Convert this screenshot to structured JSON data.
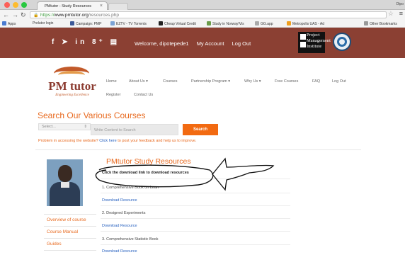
{
  "browser": {
    "tab_title": "PMtutor - Study Resources",
    "tab_close": "×",
    "profile": "Dipo",
    "url_scheme": "https://",
    "url_host": "www.pmtutor.org",
    "url_path": "/resources.php",
    "bookmarks": [
      "Apps",
      "Prelutor login",
      "Campaign: PMP",
      "EZTV - TV Torrents",
      "Cheap Virtual Credit",
      "Study in Norway!Vis",
      "GG.app",
      "Metropolis UAS - Ad"
    ],
    "other_bookmarks": "Other Bookmarks"
  },
  "banner": {
    "welcome": "Welcome, dipotepede1",
    "my_account": "My Account",
    "logout": "Log Out",
    "pmi_lines": [
      "Project",
      "Management",
      "Institute"
    ]
  },
  "logo": {
    "name": "PM tutor",
    "tagline": "Engineering Excellence"
  },
  "nav": {
    "home": "Home",
    "about": "About Us ▾",
    "courses": "Courses",
    "partnership": "Partnership Program ▾",
    "why": "Why Us ▾",
    "free": "Free Courses",
    "faq": "FAQ",
    "logout": "Log Out",
    "register": "Register",
    "contact": "Contact Us"
  },
  "search": {
    "title": "Search Our Various Courses",
    "select_value": "Select...",
    "input_placeholder": "Write Content to Search",
    "button": "Search",
    "problem_text": "Problem in accessing the website?",
    "problem_link": "Click here",
    "problem_rest": "to post your feedback and help us to improve."
  },
  "sidebar": {
    "links": [
      "Overview of course",
      "Course Manual",
      "Guides"
    ]
  },
  "resources": {
    "title": "PMtutor Study Resources",
    "instruction": "Click the download link to download resources",
    "items": [
      {
        "name": "1. Comprehensive Book on Lean",
        "link": "Download Resource"
      },
      {
        "name": "2. Designed Experiments",
        "link": "Download Resource"
      },
      {
        "name": "3. Comprehensive Statistic Book",
        "link": "Download Resource"
      }
    ]
  },
  "colors": {
    "brand_orange": "#e8691e",
    "banner_brown": "#8b4033",
    "link_blue": "#2a63c0"
  }
}
